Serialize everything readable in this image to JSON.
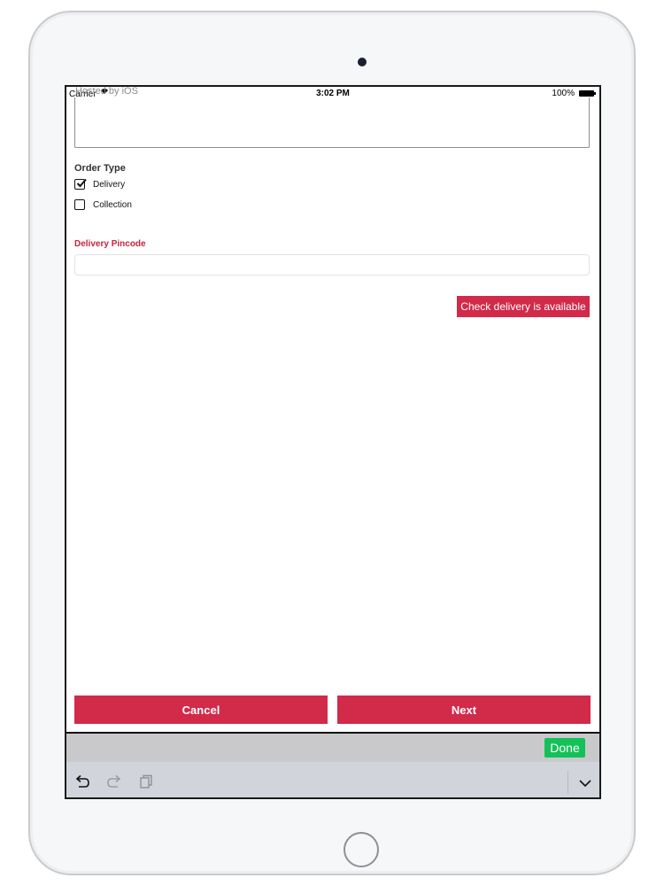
{
  "status_bar": {
    "carrier": "Carrier",
    "overlay_text": "Hosted by iOS",
    "time": "3:02 PM",
    "battery": "100%"
  },
  "form": {
    "order_type_label": "Order Type",
    "options": [
      {
        "label": "Delivery",
        "checked": true
      },
      {
        "label": "Collection",
        "checked": false
      }
    ],
    "pincode_label": "Delivery Pincode",
    "pincode_value": "",
    "check_button_label": "Check delivery is available"
  },
  "actions": {
    "cancel_label": "Cancel",
    "next_label": "Next"
  },
  "keyboard": {
    "done_label": "Done",
    "icons": [
      "undo-icon",
      "redo-icon",
      "paste-icon",
      "keyboard-dismiss-icon"
    ]
  },
  "colors": {
    "accent": "#d22a49",
    "done_green": "#13c158",
    "label_red": "#c8233f"
  }
}
